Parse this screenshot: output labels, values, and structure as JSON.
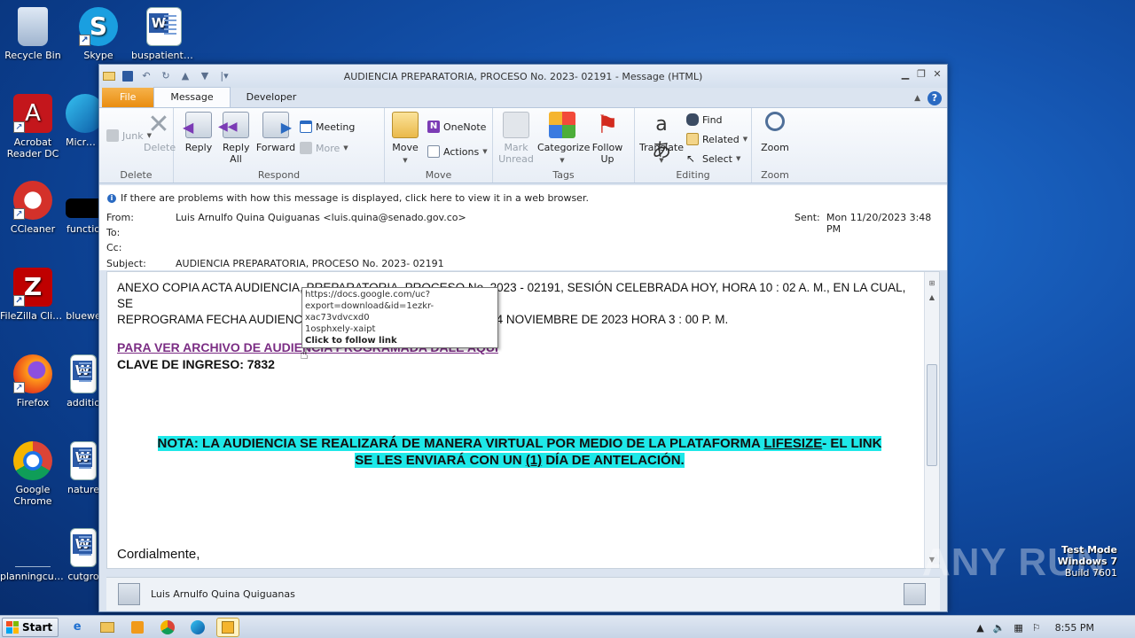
{
  "desktop": {
    "icons": [
      {
        "label": "Recycle Bin",
        "icon": "recycle-bin-icon"
      },
      {
        "label": "Skype",
        "icon": "skype-icon"
      },
      {
        "label": "buspatients...",
        "icon": "word-doc-icon"
      },
      {
        "label": "Acrobat Reader DC",
        "icon": "acrobat-icon"
      },
      {
        "label": "Microso",
        "icon": "edge-icon"
      },
      {
        "label": "CCleaner",
        "icon": "ccleaner-icon"
      },
      {
        "label": "functio",
        "icon": "file-icon"
      },
      {
        "label": "FileZilla Client",
        "icon": "filezilla-icon"
      },
      {
        "label": "bluewe",
        "icon": "file-icon"
      },
      {
        "label": "Firefox",
        "icon": "firefox-icon"
      },
      {
        "label": "additio",
        "icon": "word-doc-icon"
      },
      {
        "label": "Google Chrome",
        "icon": "chrome-icon"
      },
      {
        "label": "nature",
        "icon": "word-doc-icon"
      },
      {
        "label": "planningcul...",
        "icon": "file-icon"
      },
      {
        "label": "cutgro",
        "icon": "word-doc-icon"
      }
    ]
  },
  "window": {
    "title": "AUDIENCIA PREPARATORIA, PROCESO No. 2023- 02191 - Message (HTML)",
    "tabs": [
      "File",
      "Message",
      "Developer"
    ],
    "active_tab": "Message"
  },
  "ribbon": {
    "groups": {
      "delete": {
        "label": "Delete",
        "junk": "Junk",
        "delete": "Delete"
      },
      "respond": {
        "label": "Respond",
        "reply": "Reply",
        "reply_all": "Reply All",
        "forward": "Forward",
        "meeting": "Meeting",
        "more": "More"
      },
      "move": {
        "label": "Move",
        "move": "Move",
        "onenote": "OneNote",
        "actions": "Actions"
      },
      "tags": {
        "label": "Tags",
        "mark_unread": "Mark Unread",
        "categorize": "Categorize",
        "follow_up": "Follow Up"
      },
      "editing": {
        "label": "Editing",
        "translate": "Translate",
        "find": "Find",
        "related": "Related",
        "select": "Select"
      },
      "zoom": {
        "label": "Zoom",
        "zoom": "Zoom"
      }
    }
  },
  "header": {
    "info": "If there are problems with how this message is displayed, click here to view it in a web browser.",
    "from_label": "From:",
    "from": "Luis Arnulfo Quina Quiguanas <luis.quina@senado.gov.co>",
    "to_label": "To:",
    "cc_label": "Cc:",
    "subject_label": "Subject:",
    "subject": "AUDIENCIA PREPARATORIA, PROCESO No. 2023- 02191",
    "sent_label": "Sent:",
    "sent": "Mon 11/20/2023 3:48 PM"
  },
  "body": {
    "para_line1": "ANEXO COPIA ACTA AUDIENCIA, PREPARATORIA, PROCESO No. 2023 - 02191, SESIÓN CELEBRADA HOY, HORA 10 : 02 A. M., EN LA CUAL, SE",
    "para_line2": "REPROGRAMA FECHA AUDIENCIA PREPARATORIA, PARA EL DIA 24 NOVIEMBRE DE 2023 HORA 3 : 00 P. M.",
    "link": "PARA VER ARCHIVO DE AUDIENCIA PROGRAMADA DALE AQUI",
    "clave": "CLAVE DE INGRESO: 7832",
    "nota_a": "NOTA: LA AUDIENCIA SE REALIZARÁ DE MANERA VIRTUAL POR MEDIO DE LA PLATAFORMA ",
    "nota_b": "LIFESIZE",
    "nota_c": "- EL LINK",
    "nota_d": "SE LES ENVIARÁ CON UN ",
    "nota_e": "(1)",
    "nota_f": " DÍA DE ANTELACIÓN.",
    "closing": "Cordialmente,",
    "tooltip_url1": "https://docs.google.com/uc?",
    "tooltip_url2": "export=download&id=1ezkr-xac73vdvcxd0",
    "tooltip_url3": "1osphxely-xaipt",
    "tooltip_hint": "Click to follow link"
  },
  "people_pane": {
    "name": "Luis Arnulfo Quina Quiguanas"
  },
  "taskbar": {
    "start": "Start",
    "clock": "8:55 PM"
  },
  "watermark": {
    "line1": "Test Mode",
    "line2": "Windows 7",
    "line3": "Build 7601",
    "brand": "ANY RUN"
  },
  "colors": {
    "link": "#7b2d84",
    "highlight": "#1ee8e8",
    "file_tab": "#e98d10"
  }
}
